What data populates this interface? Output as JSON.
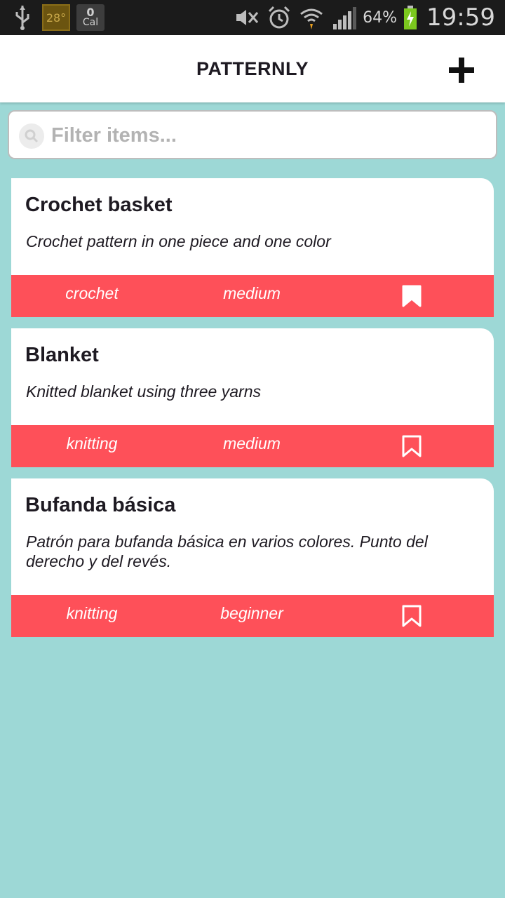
{
  "status_bar": {
    "temperature": "28°",
    "cal_count": "0",
    "cal_label": "Cal",
    "battery": "64%",
    "time": "19:59"
  },
  "header": {
    "title": "PATTERNLY",
    "add_icon": "plus-icon"
  },
  "search": {
    "placeholder": "Filter items...",
    "value": "",
    "icon": "search-icon"
  },
  "patterns": [
    {
      "title": "Crochet basket",
      "description": "Crochet pattern in one piece and one color",
      "type": "crochet",
      "level": "medium",
      "bookmarked": true
    },
    {
      "title": "Blanket",
      "description": "Knitted blanket using three yarns",
      "type": "knitting",
      "level": "medium",
      "bookmarked": false
    },
    {
      "title": "Bufanda básica",
      "description": "Patrón para bufanda básica en varios colores. Punto del derecho y del revés.",
      "type": "knitting",
      "level": "beginner",
      "bookmarked": false
    }
  ],
  "colors": {
    "background": "#9dd8d6",
    "accent": "#fe5059",
    "header": "#ffffff",
    "text": "#1e1a22"
  }
}
